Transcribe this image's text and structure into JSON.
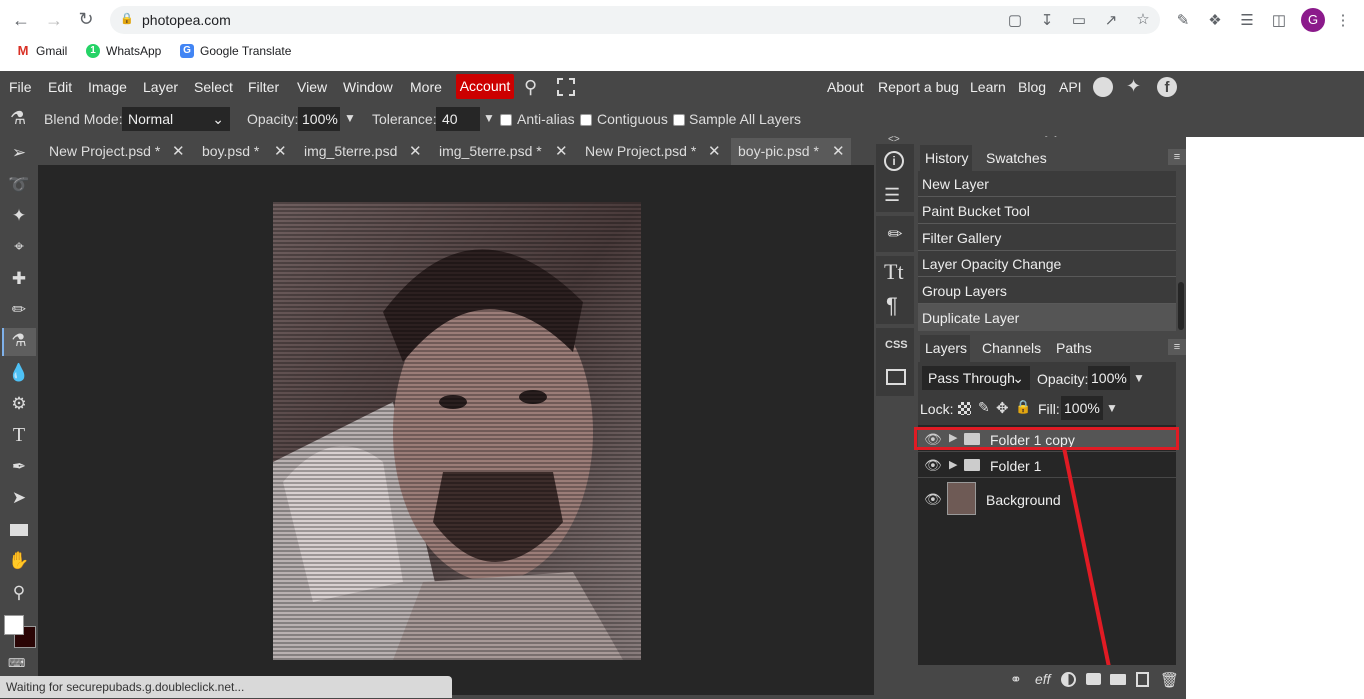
{
  "browser": {
    "url": "photopea.com",
    "bookmarks": [
      {
        "label": "Gmail",
        "icon": "gmail-icon",
        "color": "#d93025"
      },
      {
        "label": "WhatsApp",
        "icon": "whatsapp-icon",
        "color": "#25d366"
      },
      {
        "label": "Google Translate",
        "icon": "google-translate-icon",
        "color": "#4285f4"
      }
    ],
    "profile_initial": "G"
  },
  "menubar": {
    "items": [
      "File",
      "Edit",
      "Image",
      "Layer",
      "Select",
      "Filter",
      "View",
      "Window",
      "More"
    ],
    "account": "Account",
    "right_links": [
      "About",
      "Report a bug",
      "Learn",
      "Blog",
      "API"
    ]
  },
  "options": {
    "blend_label": "Blend Mode:",
    "blend_value": "Normal",
    "opacity_label": "Opacity:",
    "opacity_value": "100%",
    "tolerance_label": "Tolerance:",
    "tolerance_value": "40",
    "antialias": "Anti-alias",
    "contiguous": "Contiguous",
    "sample_all": "Sample All Layers"
  },
  "tabs": [
    {
      "label": "New Project.psd *"
    },
    {
      "label": "boy.psd *"
    },
    {
      "label": "img_5terre.psd"
    },
    {
      "label": "img_5terre.psd *"
    },
    {
      "label": "New Project.psd *"
    },
    {
      "label": "boy-pic.psd *",
      "active": true
    }
  ],
  "history_panel": {
    "tabs": [
      "History",
      "Swatches"
    ],
    "items": [
      "New Layer",
      "Paint Bucket Tool",
      "Filter Gallery",
      "Layer Opacity Change",
      "Group Layers",
      "Duplicate Layer"
    ]
  },
  "layers_panel": {
    "tabs": [
      "Layers",
      "Channels",
      "Paths"
    ],
    "blend_value": "Pass Through",
    "opacity_label": "Opacity:",
    "opacity_value": "100%",
    "lock_label": "Lock:",
    "fill_label": "Fill:",
    "fill_value": "100%",
    "layers": [
      {
        "name": "Folder 1 copy",
        "type": "folder",
        "highlighted": true
      },
      {
        "name": "Folder 1",
        "type": "folder"
      },
      {
        "name": "Background",
        "type": "image"
      }
    ],
    "footer_icons": [
      "link-icon",
      "effects-icon",
      "adjustment-icon",
      "mask-icon",
      "new-folder-icon",
      "new-layer-icon",
      "delete-icon"
    ],
    "footer_effects_text": "eff"
  },
  "status_text": "Waiting for securepubads.g.doubleclick.net...",
  "rpanel_css_label": "CSS",
  "colors": {
    "accent_red": "#e01b24",
    "account_red": "#cc0000",
    "panel_bg": "#474747",
    "dark_bg": "#262626"
  }
}
